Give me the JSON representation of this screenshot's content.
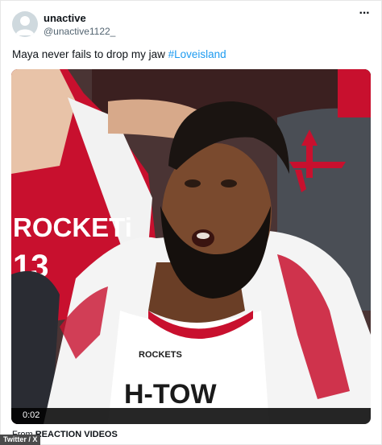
{
  "tweet": {
    "display_name": "unactive",
    "handle": "@unactive1122_",
    "text": "Maya never fails to drop my jaw ",
    "hashtag": "#Loveisland",
    "more_icon": "more-options-icon",
    "avatar_icon": "default-avatar-icon"
  },
  "video": {
    "timestamp": "0:02",
    "jersey_text": "ROCKETS",
    "jersey_text_left": "ROCKETi",
    "jersey_number": "13",
    "bottom_text": "H-TOW"
  },
  "source": {
    "prefix": "From ",
    "name": "REACTION VIDEOS"
  },
  "credit": "Twitter / X",
  "colors": {
    "hashtag": "#1d9bf0",
    "rockets_red": "#c8102e"
  }
}
